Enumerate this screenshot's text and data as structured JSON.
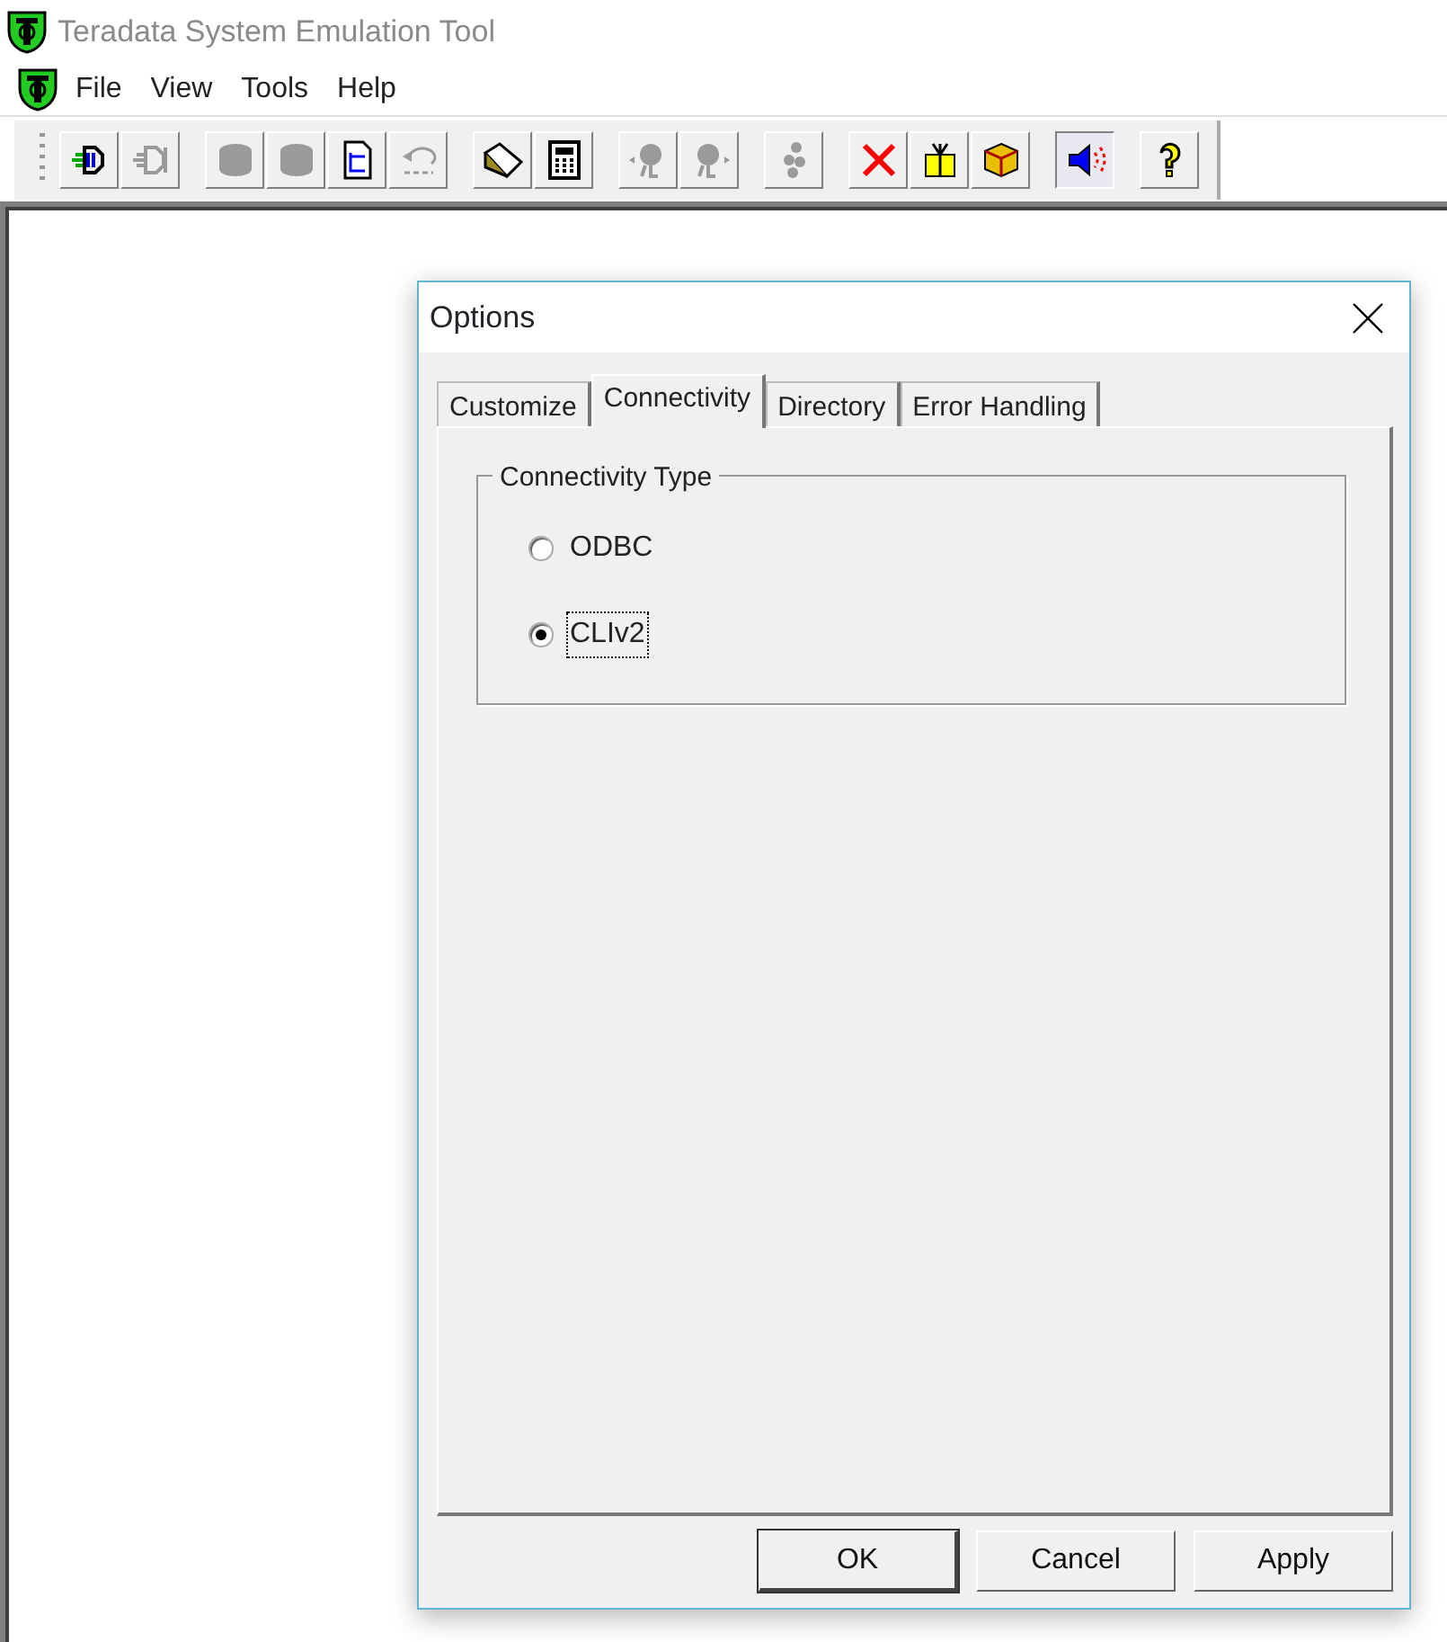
{
  "window": {
    "title": "Teradata System Emulation Tool",
    "active": false
  },
  "menu": [
    {
      "label": "File"
    },
    {
      "label": "View"
    },
    {
      "label": "Tools"
    },
    {
      "label": "Help"
    }
  ],
  "toolbar": [
    [
      {
        "disabled": false,
        "pressed": false
      },
      {
        "disabled": true,
        "pressed": false
      }
    ],
    [
      {
        "disabled": true,
        "pressed": false
      },
      {
        "disabled": true,
        "pressed": false
      },
      {
        "disabled": false,
        "pressed": false
      },
      {
        "disabled": true,
        "pressed": false
      }
    ],
    [
      {
        "disabled": false,
        "pressed": false
      },
      {
        "disabled": false,
        "pressed": false
      }
    ],
    [
      {
        "disabled": true,
        "pressed": false
      },
      {
        "disabled": true,
        "pressed": false
      }
    ],
    [
      {
        "disabled": true,
        "pressed": false
      }
    ],
    [
      {
        "disabled": false,
        "pressed": false
      },
      {
        "disabled": false,
        "pressed": false
      },
      {
        "disabled": false,
        "pressed": false
      }
    ],
    [
      {
        "disabled": false,
        "pressed": true
      }
    ],
    [
      {
        "disabled": false,
        "pressed": false
      }
    ]
  ],
  "dialog": {
    "title": "Options",
    "tabs": [
      {
        "label": "Customize",
        "selected": false
      },
      {
        "label": "Connectivity",
        "selected": true
      },
      {
        "label": "Directory",
        "selected": false
      },
      {
        "label": "Error Handling",
        "selected": false
      }
    ],
    "group": {
      "title": "Connectivity Type",
      "options": [
        {
          "label": "ODBC",
          "selected": false,
          "focused": false
        },
        {
          "label": "CLIv2",
          "selected": true,
          "focused": true
        }
      ]
    },
    "buttons": [
      {
        "label": "OK",
        "default": true
      },
      {
        "label": "Cancel",
        "default": false
      },
      {
        "label": "Apply",
        "default": false
      }
    ]
  }
}
